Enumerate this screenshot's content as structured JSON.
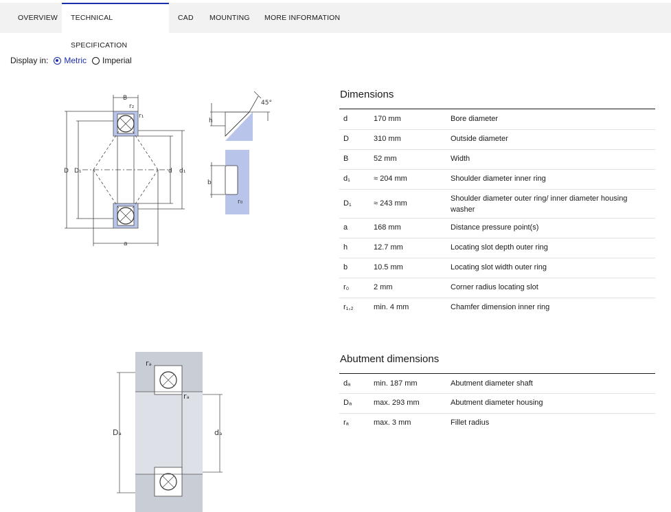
{
  "tabs": [
    {
      "label": "OVERVIEW"
    },
    {
      "label": "TECHNICAL SPECIFICATION"
    },
    {
      "label": "CAD"
    },
    {
      "label": "MOUNTING"
    },
    {
      "label": "MORE INFORMATION"
    }
  ],
  "display": {
    "label": "Display in:",
    "metric": "Metric",
    "imperial": "Imperial"
  },
  "dimensions": {
    "title": "Dimensions",
    "rows": [
      {
        "sym": "d",
        "value": "170 mm",
        "desc": "Bore diameter"
      },
      {
        "sym": "D",
        "value": "310 mm",
        "desc": "Outside diameter"
      },
      {
        "sym": "B",
        "value": "52 mm",
        "desc": "Width"
      },
      {
        "sym": "d₁",
        "value": "≈ 204 mm",
        "desc": "Shoulder diameter inner ring"
      },
      {
        "sym": "D₁",
        "value": "≈ 243 mm",
        "desc": "Shoulder diameter outer ring/ inner diameter housing washer"
      },
      {
        "sym": "a",
        "value": "168 mm",
        "desc": "Distance pressure point(s)"
      },
      {
        "sym": "h",
        "value": "12.7 mm",
        "desc": "Locating slot depth outer ring"
      },
      {
        "sym": "b",
        "value": "10.5 mm",
        "desc": "Locating slot width outer ring"
      },
      {
        "sym": "r₀",
        "value": "2 mm",
        "desc": "Corner radius locating slot"
      },
      {
        "sym": "r₁,₂",
        "value": "min. 4 mm",
        "desc": "Chamfer dimension inner ring"
      }
    ]
  },
  "abutment": {
    "title": "Abutment dimensions",
    "rows": [
      {
        "sym": "dₐ",
        "value": "min. 187 mm",
        "desc": "Abutment diameter shaft"
      },
      {
        "sym": "Dₐ",
        "value": "max. 293 mm",
        "desc": "Abutment diameter housing"
      },
      {
        "sym": "rₐ",
        "value": "max. 3 mm",
        "desc": "Fillet radius"
      }
    ]
  },
  "drawing_labels": {
    "B": "B",
    "r2": "r₂",
    "r1": "r₁",
    "D": "D",
    "D1": "D₁",
    "d": "d",
    "d1": "d₁",
    "a": "a",
    "h": "h",
    "b": "b",
    "r0": "r₀",
    "angle": "45°",
    "ra": "rₐ",
    "Da": "Dₐ",
    "da": "dₐ"
  },
  "colors": {
    "accent": "#1b2ea8",
    "bearing_fill": "#b8c4ea",
    "housing_fill": "#c8cdd6"
  }
}
